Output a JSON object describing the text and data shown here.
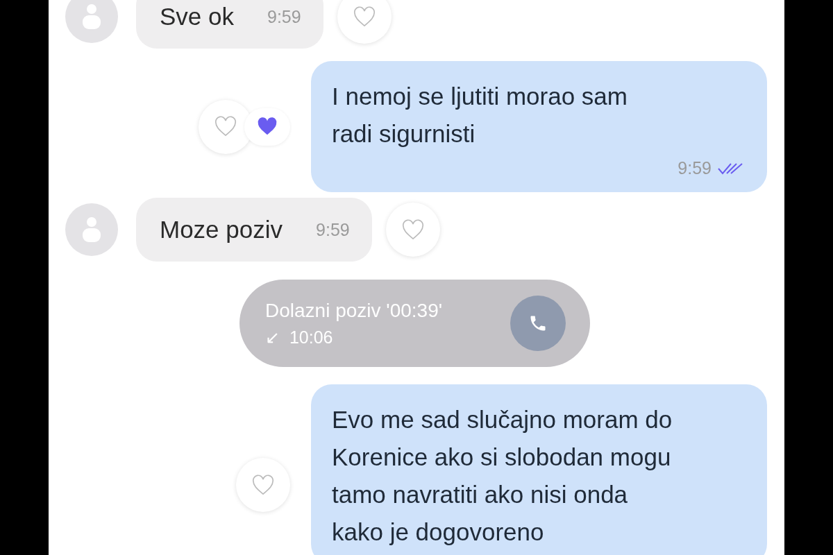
{
  "messages": [
    {
      "kind": "incoming",
      "text": "Sve ok",
      "time": "9:59",
      "reacted": false
    },
    {
      "kind": "outgoing",
      "lines": [
        "I nemoj se ljutiti morao sam",
        "radi sigurnisti"
      ],
      "time": "9:59",
      "read": true,
      "reacted": true
    },
    {
      "kind": "incoming",
      "text": "Moze poziv",
      "time": "9:59",
      "reacted": false
    },
    {
      "kind": "call",
      "text": "Dolazni poziv '00:39'",
      "arrow": "↙",
      "time": "10:06"
    },
    {
      "kind": "outgoing",
      "lines": [
        "Evo me sad slučajno moram do",
        "Korenice ako si slobodan mogu",
        "tamo navratiti ako nisi onda",
        "kako je dogovoreno"
      ],
      "reacted": false
    }
  ]
}
